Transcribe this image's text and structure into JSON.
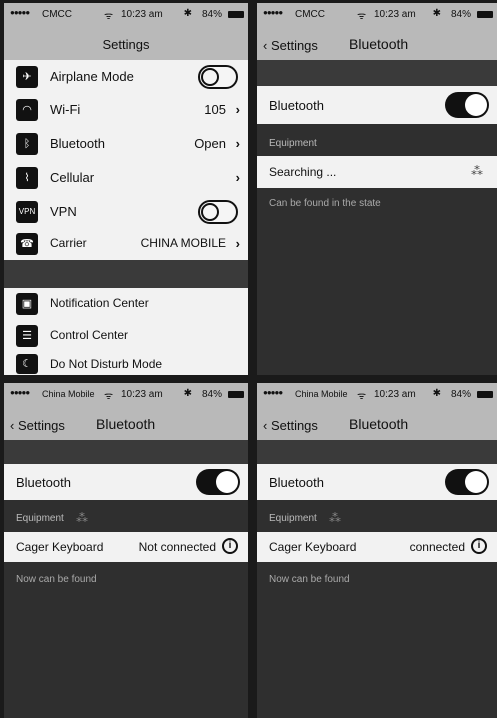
{
  "screens": [
    {
      "status": {
        "signal": "●●●●●",
        "carrier": "CMCC",
        "time": "10:23 am",
        "battery": "84%"
      },
      "nav": {
        "title": "Settings"
      },
      "items": [
        {
          "label": "Airplane Mode",
          "icon": "airplane-icon"
        },
        {
          "label": "Wi-Fi",
          "value": "105",
          "icon": "wifi-icon"
        },
        {
          "label": "Bluetooth",
          "value": "Open",
          "icon": "bluetooth-icon"
        },
        {
          "label": "Cellular",
          "icon": "cellular-icon"
        },
        {
          "label": "VPN",
          "icon": "vpn-icon"
        },
        {
          "label": "Carrier",
          "value": "CHINA MOBILE",
          "icon": "phone-icon"
        },
        {
          "label": "Notification Center",
          "icon": "notification-icon"
        },
        {
          "label": "Control Center",
          "icon": "control-center-icon"
        },
        {
          "label": "Do Not Disturb Mode",
          "icon": "moon-icon"
        }
      ],
      "vpn_icon_text": "VPN",
      "chevron": "›"
    },
    {
      "status": {
        "signal": "●●●●●",
        "carrier": "CMCC",
        "time": "10:23 am",
        "battery": "84%"
      },
      "nav": {
        "back": "‹ Settings",
        "title": "Bluetooth"
      },
      "bluetooth_label": "Bluetooth",
      "section_label": "Equipment",
      "searching": "Searching ...",
      "note": "Can be found in the state"
    },
    {
      "status": {
        "signal": "●●●●●",
        "carrier": "China Mobile",
        "time": "10:23 am",
        "battery": "84%"
      },
      "nav": {
        "back": "‹ Settings",
        "title": "Bluetooth"
      },
      "bluetooth_label": "Bluetooth",
      "section_label": "Equipment",
      "device": "Cager Keyboard",
      "device_status": "Not connected",
      "note": "Now can be found"
    },
    {
      "status": {
        "signal": "●●●●●",
        "carrier": "China Mobile",
        "time": "10:23 am",
        "battery": "84%"
      },
      "nav": {
        "back": "‹ Settings",
        "title": "Bluetooth"
      },
      "bluetooth_label": "Bluetooth",
      "section_label": "Equipment",
      "device": "Cager Keyboard",
      "device_status": "connected",
      "note": "Now can be found"
    }
  ],
  "glyphs": {
    "wifi": "ᯤ",
    "bt": "✱",
    "spinner": "⁂",
    "info": "i"
  }
}
